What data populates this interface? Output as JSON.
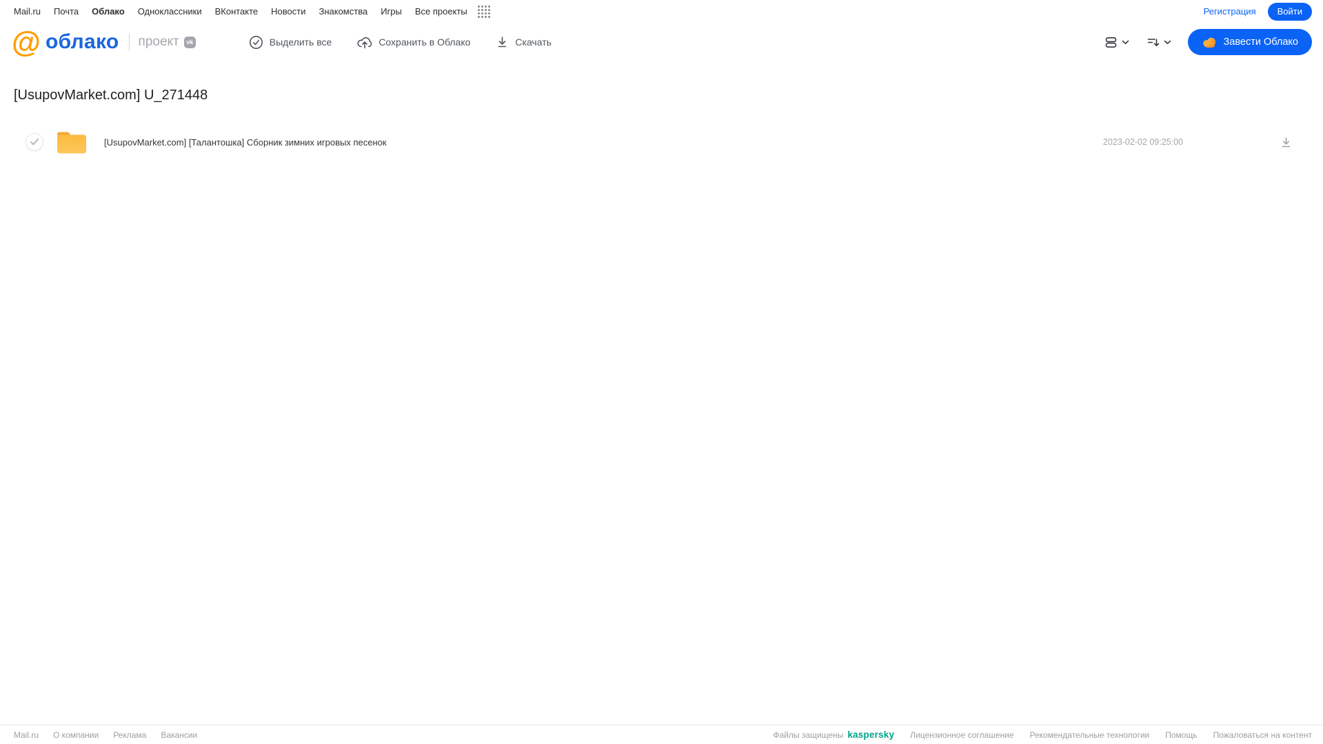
{
  "topnav": {
    "items": [
      "Mail.ru",
      "Почта",
      "Облако",
      "Одноклассники",
      "ВКонтакте",
      "Новости",
      "Знакомства",
      "Игры",
      "Все проекты"
    ],
    "active_item": "Облако",
    "registration_label": "Регистрация",
    "login_label": "Войти"
  },
  "header": {
    "logo_at": "@",
    "logo_text": "облако",
    "project_label": "проект",
    "vk_badge": "vk",
    "toolbar": {
      "select_all": "Выделить все",
      "save_to_cloud": "Сохранить в Облако",
      "download": "Скачать"
    },
    "create_cloud_button": "Завести Облако"
  },
  "main": {
    "title": "[UsupovMarket.com] U_271448",
    "files": [
      {
        "type": "folder",
        "name": "[UsupovMarket.com] [Талантошка] Сборник зимних игровых песенок",
        "date": "2023-02-02 09:25:00"
      }
    ]
  },
  "footer": {
    "left_links": [
      "Mail.ru",
      "О компании",
      "Реклама",
      "Вакансии"
    ],
    "protected_label": "Файлы защищены",
    "kaspersky_label": "kaspersky",
    "right_links": [
      "Лицензионное соглашение",
      "Рекомендательные технологии",
      "Помощь",
      "Пожаловаться на контент"
    ]
  },
  "colors": {
    "accent_blue": "#0b63f6",
    "logo_orange": "#ff9e00",
    "logo_blue": "#1b66dd",
    "folder_yellow": "#fcbf47",
    "kaspersky_teal": "#00a38a",
    "muted_gray": "#9b9ea3"
  }
}
